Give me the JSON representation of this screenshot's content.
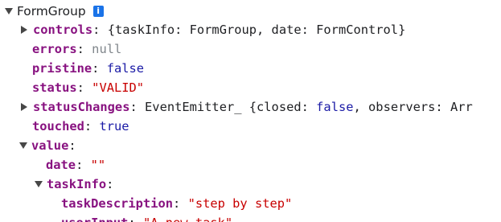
{
  "root": {
    "label": "FormGroup",
    "info_icon": "i"
  },
  "rows": {
    "controls": {
      "key": "controls",
      "value": "{taskInfo: FormGroup, date: FormControl}"
    },
    "errors": {
      "key": "errors",
      "value": "null"
    },
    "pristine": {
      "key": "pristine",
      "value": "false"
    },
    "status": {
      "key": "status",
      "value": "\"VALID\""
    },
    "statusChanges": {
      "key": "statusChanges",
      "prefix": "EventEmitter_ {closed: ",
      "closed": "false",
      "suffix": ", observers: Arr"
    },
    "touched": {
      "key": "touched",
      "value": "true"
    },
    "value": {
      "key": "value"
    },
    "date": {
      "key": "date",
      "value": "\"\""
    },
    "taskInfo": {
      "key": "taskInfo"
    },
    "taskDescription": {
      "key": "taskDescription",
      "value": "\"step by step\""
    },
    "userInput": {
      "key": "userInput",
      "value": "\"A new task\""
    }
  },
  "punctuation": {
    "colon": ":"
  },
  "colors": {
    "key": "#881280",
    "string": "#c80000",
    "boolean": "#1a1aa6",
    "null": "#80868b",
    "info": "#1a73e8"
  },
  "icons": {
    "expanded": "triangle-down-icon",
    "collapsed": "triangle-right-icon",
    "info": "info-icon"
  }
}
